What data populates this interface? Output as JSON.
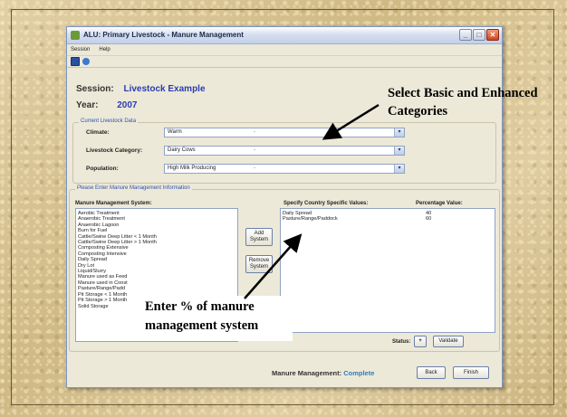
{
  "window": {
    "title": "ALU: Primary Livestock - Manure Management",
    "menu": [
      "Session",
      "Help"
    ],
    "toolbar_icons": [
      "save-icon",
      "info-icon"
    ],
    "controls": [
      "minimize",
      "maximize",
      "close"
    ]
  },
  "session": {
    "session_label": "Session:",
    "session_value": "Livestock Example",
    "year_label": "Year:",
    "year_value": "2007"
  },
  "current_data": {
    "group_title": "Current Livestock Data",
    "climate_label": "Climate:",
    "climate_value": "Warm",
    "category_label": "Livestock Category:",
    "category_value": "Dairy Cows",
    "population_label": "Population:",
    "population_value": "High Milk Producing",
    "separator": "-"
  },
  "manure": {
    "group_title": "Please Enter Manure Management Information",
    "system_header": "Manure Management System:",
    "specify_header": "Specify Country Specific Values:",
    "percent_header": "Percentage Value:",
    "systems": [
      "Aerobic Treatment",
      "Anaerobic Treatment",
      "Anaerobic Lagoon",
      "Burn for Fuel",
      "Cattle/Swine Deep Litter < 1 Month",
      "Cattle/Swine Deep Litter > 1 Month",
      "Composting Extensive",
      "Composting Intensive",
      "Daily Spread",
      "Dry Lot",
      "Liquid/Slurry",
      "Manure used as Feed",
      "Manure used in Const",
      "Pasture/Range/Padd",
      "Pit Storage < 1 Month",
      "Pit Storage > 1 Month",
      "Solid Storage"
    ],
    "selected": [
      "Daily Spread",
      "Pasture/Range/Paddock"
    ],
    "percentages": [
      "40",
      "60"
    ],
    "add_button": "Add System",
    "remove_button": "Remove System",
    "status_label": "Status:",
    "status_value": "+",
    "validate_button": "Validate"
  },
  "footer": {
    "status_prefix": "Manure Management:",
    "status_value": "Complete",
    "back_button": "Back",
    "finish_button": "Finish"
  },
  "annotations": {
    "top": "Select Basic and Enhanced Categories",
    "bottom": "Enter % of manure management system"
  },
  "colors": {
    "accent_blue": "#2a3cb0",
    "status_complete": "#2a7fc0",
    "window_bg": "#ece9d8",
    "slide_bg": "#d9c69b"
  }
}
